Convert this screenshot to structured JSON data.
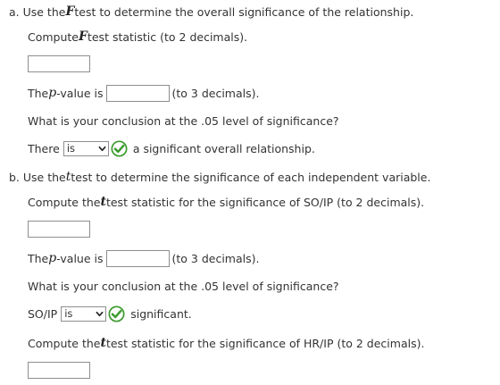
{
  "part_a": {
    "heading_prefix": "a. Use the ",
    "heading_var": "F",
    "heading_suffix": " test to determine the overall significance of the relationship.",
    "compute_prefix": "Compute ",
    "compute_var": "F",
    "compute_suffix": " test statistic (to 2 decimals).",
    "f_stat_value": "",
    "pvalue_prefix": "The ",
    "pvalue_var": "p",
    "pvalue_mid": "-value is",
    "pvalue_value": "",
    "pvalue_suffix": "(to 3 decimals).",
    "conclusion_question": "What is your conclusion at the .05 level of significance?",
    "there_label": "There",
    "select_value": "is",
    "conclusion_suffix": "a significant overall relationship."
  },
  "part_b": {
    "heading_prefix": "b. Use the ",
    "heading_var": "t",
    "heading_suffix": " test to determine the significance of each independent variable.",
    "compute1_prefix": "Compute the ",
    "compute1_var": "t",
    "compute1_suffix": " test statistic for the significance of SO/IP (to 2 decimals).",
    "t_stat1_value": "",
    "pvalue_prefix": "The ",
    "pvalue_var": "p",
    "pvalue_mid": "-value is",
    "pvalue_value": "",
    "pvalue_suffix": "(to 3 decimals).",
    "conclusion_question": "What is your conclusion at the .05 level of significance?",
    "soip_label": "SO/IP",
    "select_value": "is",
    "conclusion_suffix": "significant.",
    "compute2_prefix": "Compute the ",
    "compute2_var": "t",
    "compute2_suffix": " test statistic for the significance of HR/IP (to 2 decimals).",
    "t_stat2_value": ""
  },
  "colors": {
    "check_green": "#3c9a2e",
    "input_border": "#8e8e8e",
    "text": "#333333"
  }
}
